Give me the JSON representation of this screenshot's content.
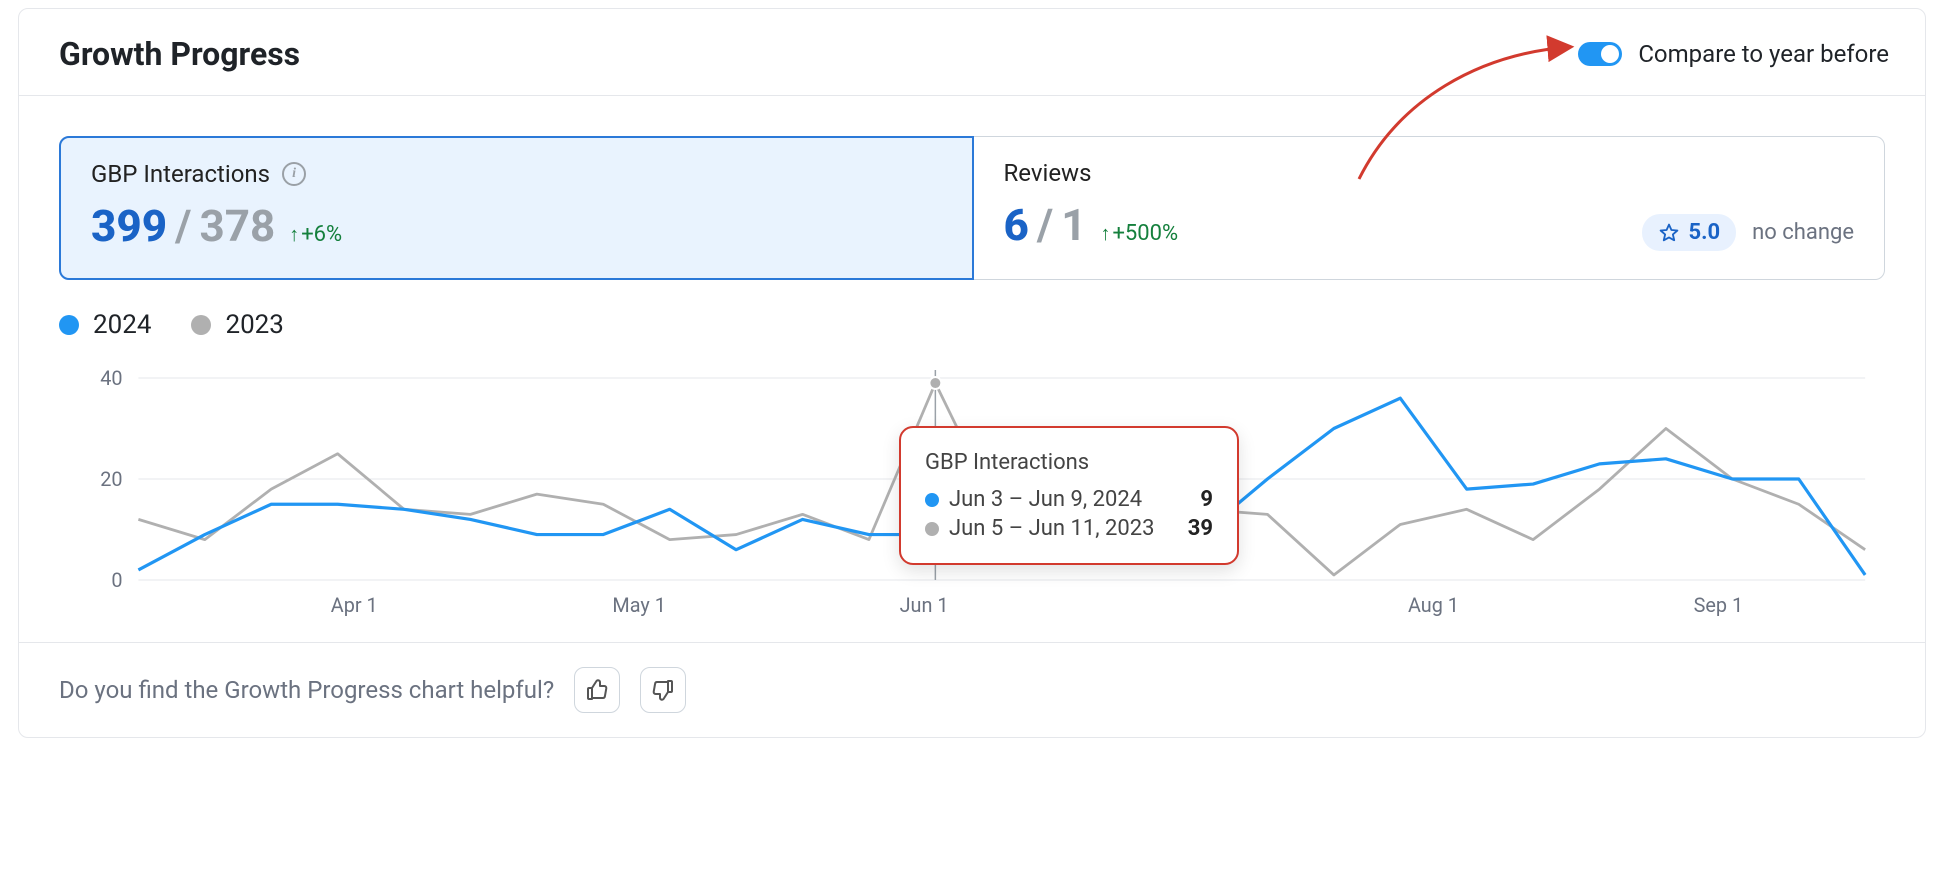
{
  "header": {
    "title": "Growth Progress",
    "compare_label": "Compare to year before",
    "compare_on": true
  },
  "cards": {
    "gbp": {
      "title": "GBP Interactions",
      "value_current": "399",
      "value_prev": "378",
      "delta": "+6%"
    },
    "reviews": {
      "title": "Reviews",
      "value_current": "6",
      "value_prev": "1",
      "delta": "+500%",
      "rating": "5.0",
      "rating_change": "no change"
    }
  },
  "legend": {
    "current_year": "2024",
    "prev_year": "2023"
  },
  "tooltip": {
    "title": "GBP Interactions",
    "row1_label": "Jun 3 – Jun 9, 2024",
    "row1_value": "9",
    "row2_label": "Jun 5 – Jun 11, 2023",
    "row2_value": "39"
  },
  "footer": {
    "question": "Do you find the Growth Progress chart helpful?"
  },
  "colors": {
    "blue": "#2196f3",
    "gray": "#b0b0b0"
  },
  "chart_data": {
    "type": "line",
    "title": "GBP Interactions",
    "xlabel": "",
    "ylabel": "",
    "ylim": [
      0,
      40
    ],
    "y_ticks": [
      0,
      20,
      40
    ],
    "x_tick_labels": [
      "Apr 1",
      "May 1",
      "Jun 1",
      "Aug 1",
      "Sep 1"
    ],
    "x_tick_positions_pct": [
      12.5,
      29,
      45.5,
      75,
      91.5
    ],
    "hover_index": 12,
    "series": [
      {
        "name": "2024",
        "color": "#2196f3",
        "values": [
          2,
          9,
          15,
          15,
          14,
          12,
          9,
          9,
          14,
          6,
          12,
          9,
          9,
          18,
          22,
          16,
          9,
          20,
          30,
          36,
          18,
          19,
          23,
          24,
          20,
          20,
          1
        ]
      },
      {
        "name": "2023",
        "color": "#b0b0b0",
        "values": [
          12,
          8,
          18,
          25,
          14,
          13,
          17,
          15,
          8,
          9,
          13,
          8,
          39,
          12,
          23,
          15,
          14,
          13,
          1,
          11,
          14,
          8,
          18,
          30,
          20,
          15,
          6
        ]
      }
    ]
  }
}
